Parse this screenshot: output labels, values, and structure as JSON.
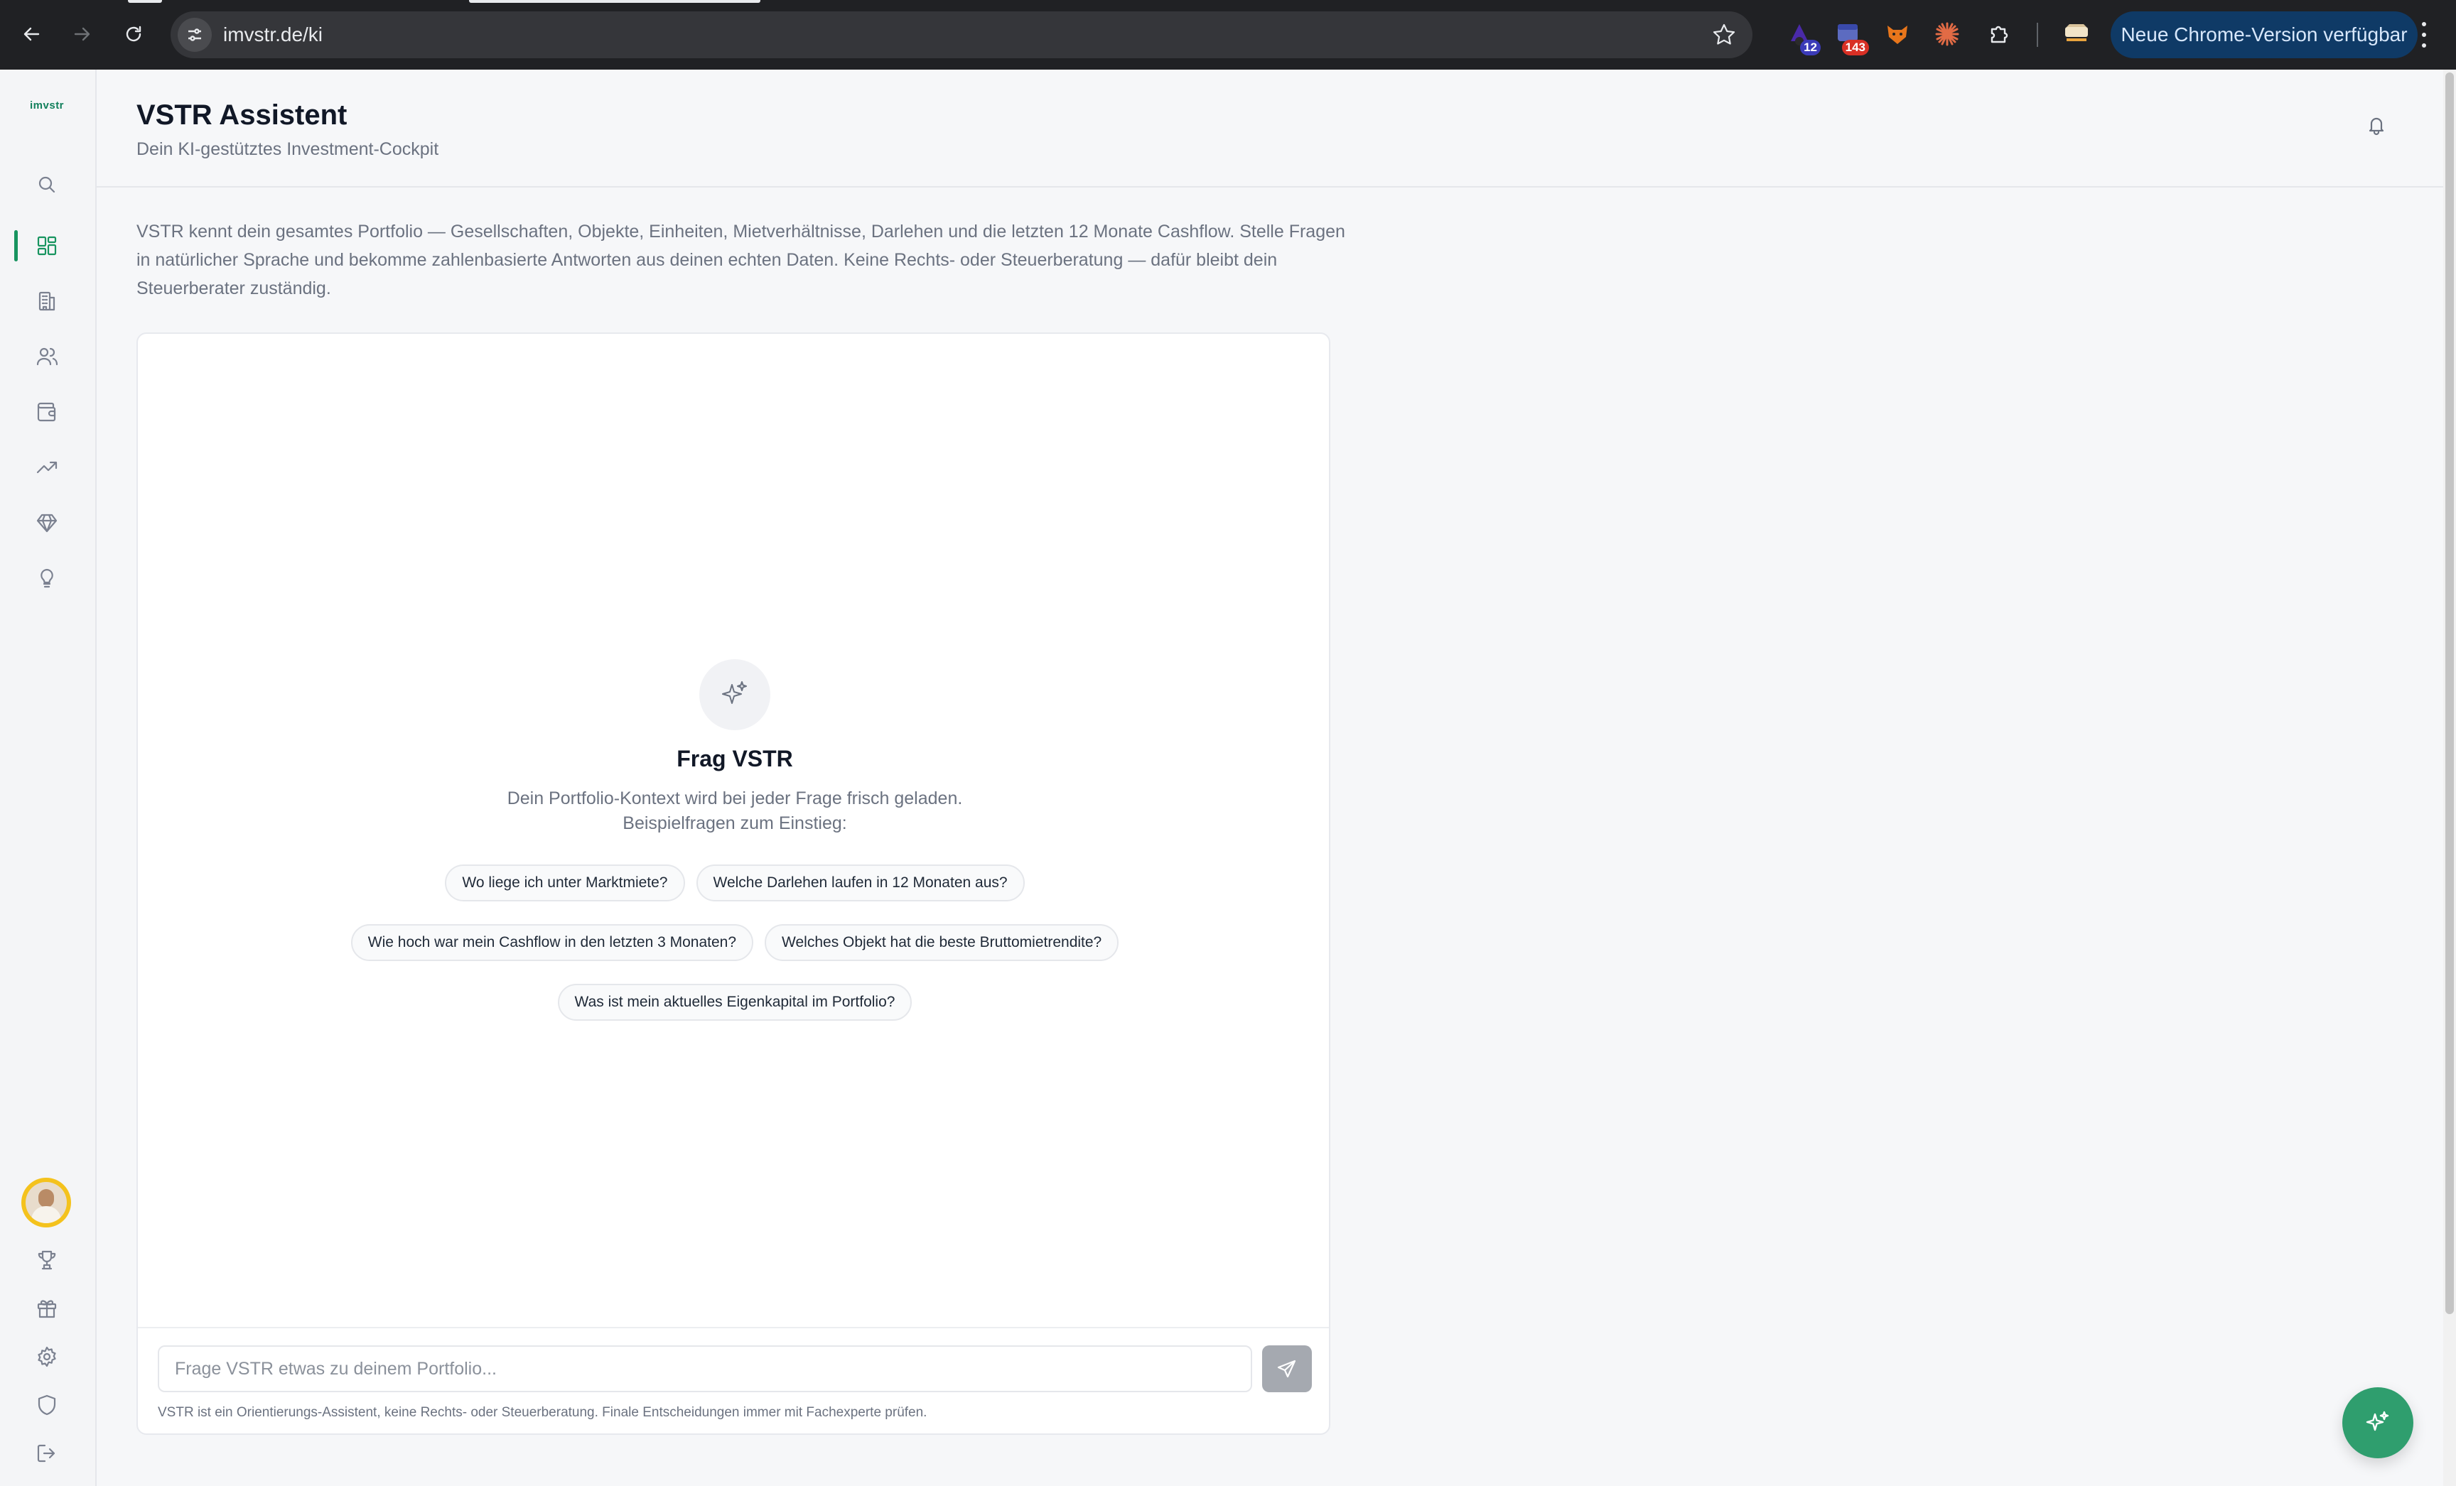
{
  "browser": {
    "url": "imvstr.de/ki",
    "update_label": "Neue Chrome-Version verfügbar",
    "extensions": [
      {
        "name": "wizard-extension-icon",
        "badge": "12",
        "badge_color": "#3b3bb8"
      },
      {
        "name": "calendar-extension-icon",
        "badge": "143",
        "badge_color": "#d93025"
      },
      {
        "name": "fox-extension-icon",
        "badge": ""
      },
      {
        "name": "sun-extension-icon",
        "badge": ""
      },
      {
        "name": "puzzle-icon",
        "badge": ""
      },
      {
        "name": "profile-extension-icon",
        "badge": ""
      }
    ]
  },
  "sidebar": {
    "logo": "imvstr",
    "items": [
      {
        "name": "search-icon",
        "active": false
      },
      {
        "name": "dashboard-icon",
        "active": true
      },
      {
        "name": "building-icon",
        "active": false
      },
      {
        "name": "users-icon",
        "active": false
      },
      {
        "name": "wallet-icon",
        "active": false
      },
      {
        "name": "trend-icon",
        "active": false
      },
      {
        "name": "diamond-icon",
        "active": false
      },
      {
        "name": "lightbulb-icon",
        "active": false
      }
    ],
    "bottom_items": [
      "trophy-icon",
      "gift-icon",
      "gear-icon",
      "shield-icon",
      "logout-icon"
    ],
    "accent": "#17945f"
  },
  "header": {
    "title": "VSTR Assistent",
    "subtitle": "Dein KI-gestütztes Investment-Cockpit"
  },
  "intro": "VSTR kennt dein gesamtes Portfolio — Gesellschaften, Objekte, Einheiten, Mietverhältnisse, Darlehen und die letzten 12 Monate Cashflow. Stelle Fragen in natürlicher Sprache und bekomme zahlenbasierte Antworten aus deinen echten Daten. Keine Rechts- oder Steuerberatung — dafür bleibt dein Steuerberater zuständig.",
  "chat": {
    "empty_title": "Frag VSTR",
    "empty_desc_line1": "Dein Portfolio-Kontext wird bei jeder Frage frisch geladen.",
    "empty_desc_line2": "Beispielfragen zum Einstieg:",
    "suggestions": [
      "Wo liege ich unter Marktmiete?",
      "Welche Darlehen laufen in 12 Monaten aus?",
      "Wie hoch war mein Cashflow in den letzten 3 Monaten?",
      "Welches Objekt hat die beste Bruttomietrendite?",
      "Was ist mein aktuelles Eigenkapital im Portfolio?"
    ],
    "input_placeholder": "Frage VSTR etwas zu deinem Portfolio...",
    "input_value": "",
    "disclaimer": "VSTR ist ein Orientierungs-Assistent, keine Rechts- oder Steuerberatung. Finale Entscheidungen immer mit Fachexperte prüfen."
  },
  "fab_color": "#2f9e6e"
}
